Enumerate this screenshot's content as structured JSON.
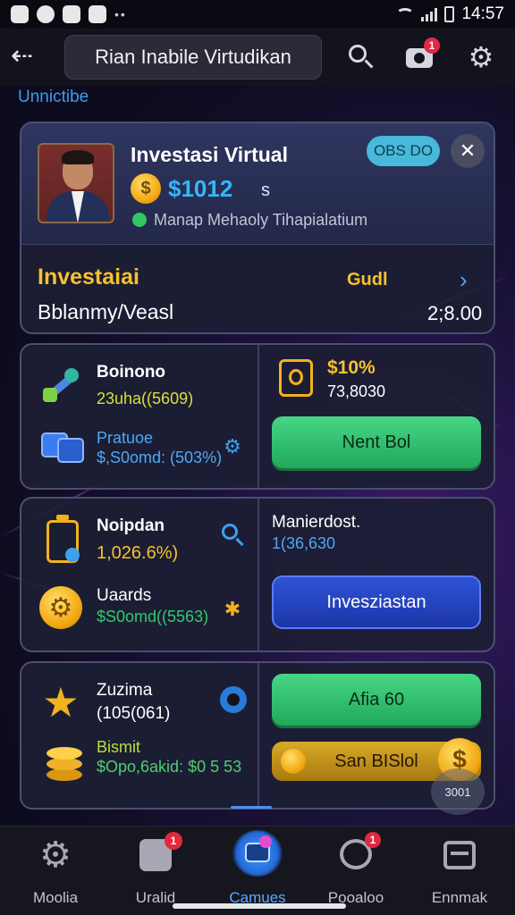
{
  "status_bar": {
    "time": "14:57",
    "dots": "••"
  },
  "topbar": {
    "title": "Rian Inabile Virtudikan",
    "camera_badge": "1"
  },
  "section_label": "Unnictibe",
  "hero": {
    "title": "Investasi Virtual",
    "amount": "$1012",
    "amount_suffix": "s",
    "subtitle": "Manap Mehaoly Tihapialatium",
    "status_pill": "OBS DO",
    "heading": "Investaiai",
    "heading_right": "Gudl",
    "line2_left": "Bblanmy/Veasl",
    "line2_right": "2;8.00"
  },
  "row1": {
    "item1_label": "Boinono",
    "item1_value": "23uha((5609)",
    "item2_label": "Pratuoe",
    "item2_value": "$,S0omd: (503%)",
    "right_pct": "$10%",
    "right_value": "73,8030",
    "button": "Nent Bol"
  },
  "row2": {
    "item1_label": "Noipdan",
    "item1_value": "1,026.6%)",
    "item2_label": "Uaards",
    "item2_value": "$S0omd((5563)",
    "right_label": "Manierdost.",
    "right_value": "1(36,630",
    "button": "Invesziastan"
  },
  "row3": {
    "item1_label": "Zuzima",
    "item1_value": "(105(061)",
    "item2_label": "Bismit",
    "item2_value": "$Opo,6akid: $0 5 53",
    "button_top": "Afia 60",
    "button_bottom": "San BISlol",
    "fab_label": "3001"
  },
  "bottom_nav": [
    {
      "label": "Moolia",
      "badge": ""
    },
    {
      "label": "Uralid",
      "badge": "1"
    },
    {
      "label": "Camues",
      "badge": ""
    },
    {
      "label": "Pooaloo",
      "badge": "1"
    },
    {
      "label": "Ennmak",
      "badge": ""
    }
  ],
  "colors": {
    "accent_blue": "#3b9df2",
    "gold": "#f5c22c",
    "green": "#31c765",
    "badge_red": "#e3283f"
  }
}
